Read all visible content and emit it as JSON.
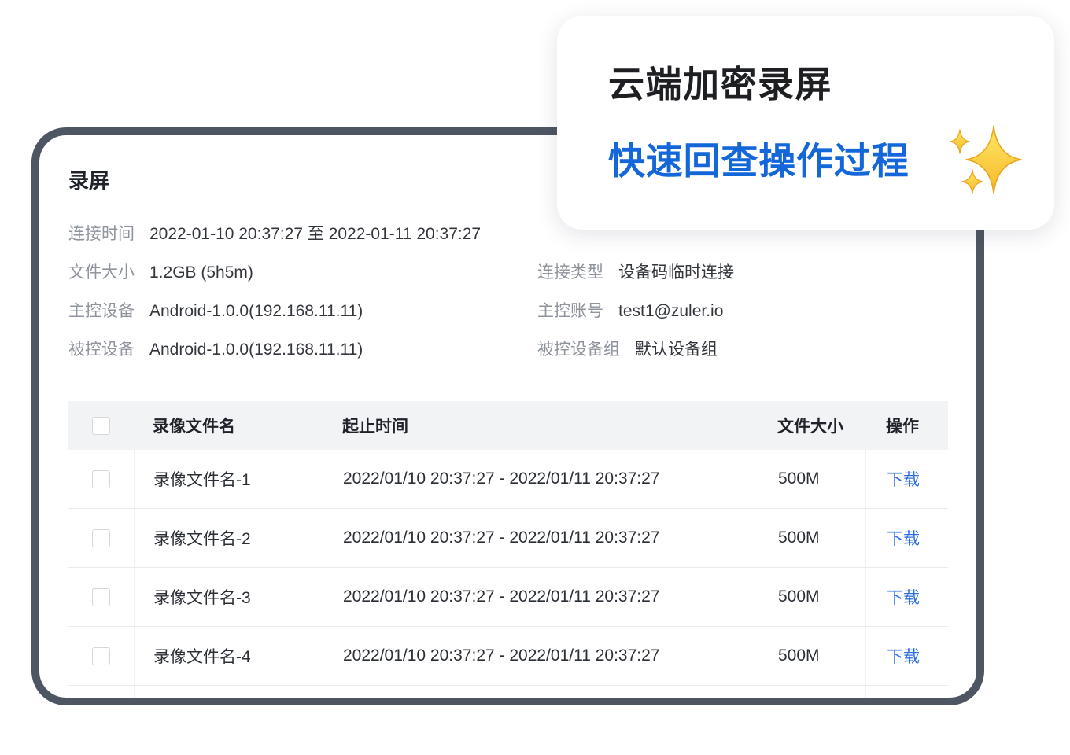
{
  "recording": {
    "title": "录屏",
    "info": [
      [
        {
          "label": "连接时间",
          "value": "2022-01-10 20:37:27 至 2022-01-11 20:37:27"
        }
      ],
      [
        {
          "label": "文件大小",
          "value": "1.2GB (5h5m)"
        },
        {
          "label": "连接类型",
          "value": "设备码临时连接"
        }
      ],
      [
        {
          "label": "主控设备",
          "value": "Android-1.0.0(192.168.11.11)"
        },
        {
          "label": "主控账号",
          "value": "test1@zuler.io"
        }
      ],
      [
        {
          "label": "被控设备",
          "value": "Android-1.0.0(192.168.11.11)"
        },
        {
          "label": "被控设备组",
          "value": "默认设备组"
        }
      ]
    ],
    "table": {
      "columns": {
        "name": "录像文件名",
        "time": "起止时间",
        "size": "文件大小",
        "action": "操作"
      },
      "rows": [
        {
          "name": "录像文件名-1",
          "time": "2022/01/10 20:37:27 - 2022/01/11 20:37:27",
          "size": "500M",
          "action": "下载"
        },
        {
          "name": "录像文件名-2",
          "time": "2022/01/10 20:37:27 - 2022/01/11 20:37:27",
          "size": "500M",
          "action": "下载"
        },
        {
          "name": "录像文件名-3",
          "time": "2022/01/10 20:37:27 - 2022/01/11 20:37:27",
          "size": "500M",
          "action": "下载"
        },
        {
          "name": "录像文件名-4",
          "time": "2022/01/10 20:37:27 - 2022/01/11 20:37:27",
          "size": "500M",
          "action": "下载"
        }
      ]
    }
  },
  "promo": {
    "title": "云端加密录屏",
    "subtitle": "快速回查操作过程",
    "icon": "sparkles-icon"
  },
  "colors": {
    "accent": "#1467d8",
    "link": "#2e6fdf",
    "frame": "#4f5663",
    "header_bg": "#f2f3f5"
  }
}
